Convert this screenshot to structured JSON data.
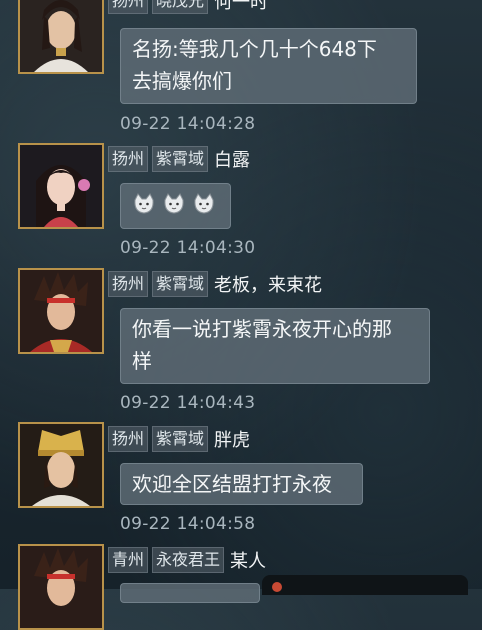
{
  "messages": [
    {
      "tags": [
        "扬州",
        "晓茂兄"
      ],
      "sender": "何一时",
      "text_lines": [
        "名扬:等我几个几十个648下",
        "去搞爆你们"
      ],
      "time": "09-22 14:04:28"
    },
    {
      "tags": [
        "扬州",
        "紫霄域"
      ],
      "sender": "白露",
      "emoji": [
        "cat-face-icon",
        "cat-face-icon",
        "cat-face-icon"
      ],
      "time": "09-22 14:04:30"
    },
    {
      "tags": [
        "扬州",
        "紫霄域"
      ],
      "sender": "老板，来束花",
      "text_lines": [
        "你看一说打紫霄永夜开心的那",
        "样"
      ],
      "time": "09-22 14:04:43"
    },
    {
      "tags": [
        "扬州",
        "紫霄域"
      ],
      "sender": "胖虎",
      "text_lines": [
        "欢迎全区结盟打打永夜"
      ],
      "time": "09-22 14:04:58"
    },
    {
      "tags": [
        "青州",
        "永夜君王"
      ],
      "sender": "某人"
    }
  ]
}
